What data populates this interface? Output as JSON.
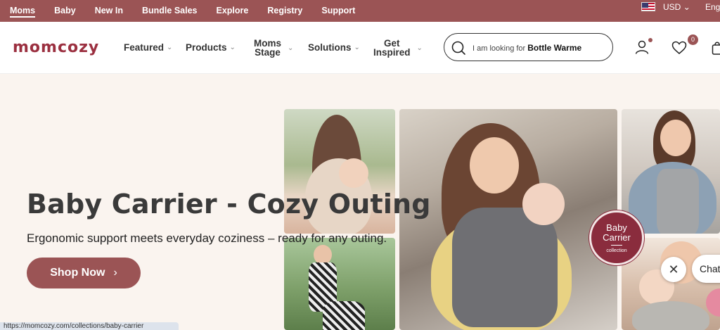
{
  "topbar": {
    "nav": [
      "Moms",
      "Baby",
      "New In",
      "Bundle Sales",
      "Explore",
      "Registry",
      "Support"
    ],
    "active_index": 0,
    "currency": "USD",
    "language": "Eng",
    "bg_color": "#9b5455"
  },
  "header": {
    "logo": "momcozy",
    "nav": {
      "featured": "Featured",
      "products": "Products",
      "moms_stage_1": "Moms",
      "moms_stage_2": "Stage",
      "solutions": "Solutions",
      "get_inspired_1": "Get",
      "get_inspired_2": "Inspired"
    },
    "search": {
      "prefix": "I am looking for",
      "query": "Bottle Warme"
    },
    "wishlist_count": "0",
    "icons": [
      "search-icon",
      "user-icon",
      "heart-icon",
      "cart-icon"
    ]
  },
  "hero": {
    "title": "Baby Carrier - Cozy Outing",
    "subtitle": "Ergonomic support meets everyday coziness – ready for any outing.",
    "cta": "Shop Now",
    "seal": {
      "line1": "Baby",
      "line2": "Carrier",
      "line3": "collection"
    }
  },
  "chat": {
    "label": "Chat"
  },
  "status_url": "https://momcozy.com/collections/baby-carrier"
}
